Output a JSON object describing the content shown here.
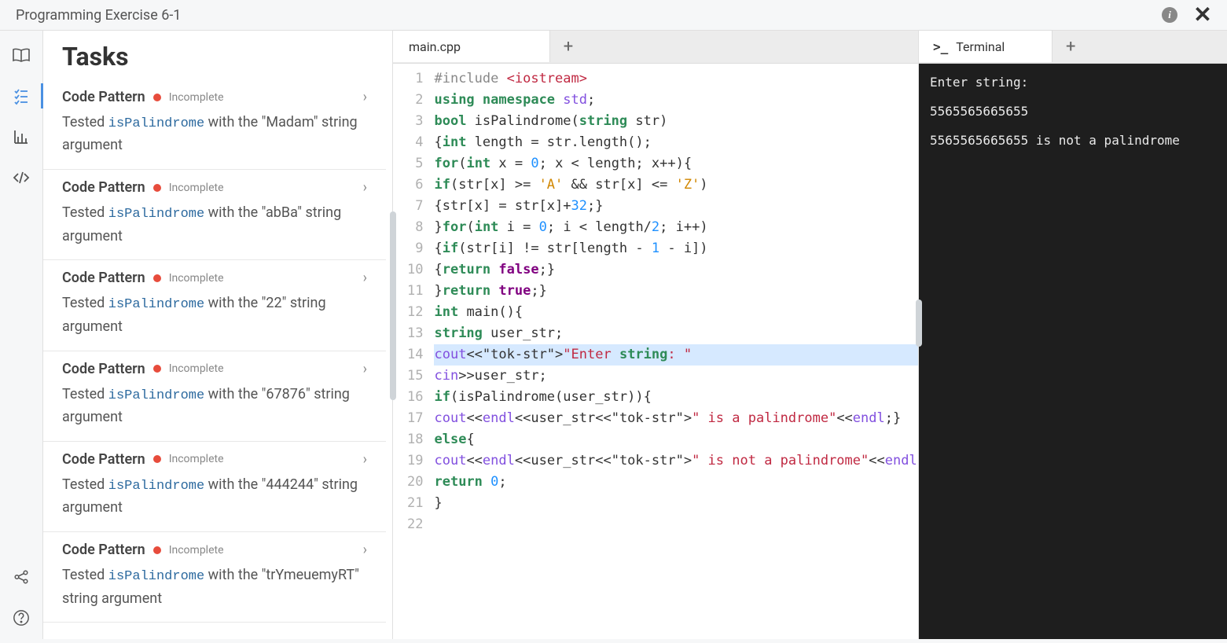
{
  "header": {
    "title": "Programming Exercise 6-1"
  },
  "tasksPanel": {
    "heading": "Tasks",
    "items": [
      {
        "title": "Code Pattern",
        "status": "Incomplete",
        "func": "isPalindrome",
        "prefix": "Tested ",
        "suffix": " with the \"Madam\" string argument"
      },
      {
        "title": "Code Pattern",
        "status": "Incomplete",
        "func": "isPalindrome",
        "prefix": "Tested ",
        "suffix": " with the \"abBa\" string argument"
      },
      {
        "title": "Code Pattern",
        "status": "Incomplete",
        "func": "isPalindrome",
        "prefix": "Tested ",
        "suffix": " with the \"22\" string argument"
      },
      {
        "title": "Code Pattern",
        "status": "Incomplete",
        "func": "isPalindrome",
        "prefix": "Tested ",
        "suffix": " with the \"67876\" string argument"
      },
      {
        "title": "Code Pattern",
        "status": "Incomplete",
        "func": "isPalindrome",
        "prefix": "Tested ",
        "suffix": " with the \"444244\" string argument"
      },
      {
        "title": "Code Pattern",
        "status": "Incomplete",
        "func": "isPalindrome",
        "prefix": "Tested ",
        "suffix": " with the \"trYmeuemyRT\" string argument"
      }
    ]
  },
  "editor": {
    "tabs": [
      {
        "label": "main.cpp"
      }
    ],
    "highlightedLine": 14,
    "code": {
      "lines": [
        "#include <iostream>",
        "using namespace std;",
        "bool isPalindrome(string str)",
        "{int length = str.length();",
        "for(int x = 0; x < length; x++){",
        "if(str[x] >= 'A' && str[x] <= 'Z')",
        "{str[x] = str[x]+32;}",
        "}for(int i = 0; i < length/2; i++)",
        "{if(str[i] != str[length - 1 - i])",
        "{return false;}",
        "}return true;}",
        "int main(){",
        "string user_str;",
        "cout<<\"Enter string: \";",
        "cin>>user_str;",
        "if(isPalindrome(user_str)){",
        "cout<<endl<<user_str<<\" is a palindrome\"<<endl;}",
        "else{",
        "cout<<endl<<user_str<<\" is not a palindrome\"<<endl;}",
        "return 0;",
        "}",
        ""
      ]
    }
  },
  "terminal": {
    "tabLabel": "Terminal",
    "output": [
      "Enter string:",
      "5565565665655",
      "5565565665655 is not a palindrome"
    ]
  }
}
